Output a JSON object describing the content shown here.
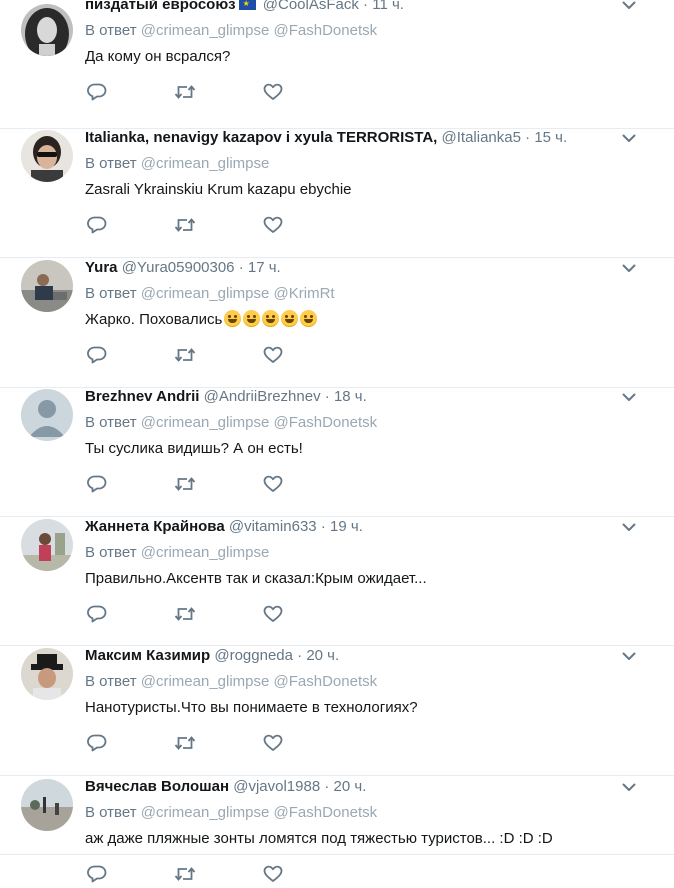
{
  "reply_prefix": "В ответ",
  "tweets": [
    {
      "name": "пиздатый евросоюз",
      "handle": "@CoolAsFack",
      "time": "11 ч.",
      "reply_mentions": "@crimean_glimpse @FashDonetsk",
      "text": "Да кому он всрался?",
      "has_flag": true,
      "emoji_count": 0
    },
    {
      "name": "Italianka, nenavigy kazapov i xyula TERRORISTA,",
      "handle": "@Italianka5",
      "time": "15 ч.",
      "reply_mentions": "@crimean_glimpse",
      "text": "Zasrali Ykrainskiu Krum kazapu ebychie",
      "has_flag": false,
      "emoji_count": 0
    },
    {
      "name": "Yura",
      "handle": "@Yura05900306",
      "time": "17 ч.",
      "reply_mentions": "@crimean_glimpse @KrimRt",
      "text": "Жарко. Поховались",
      "has_flag": false,
      "emoji_count": 5
    },
    {
      "name": "Brezhnev Andrii",
      "handle": "@AndriiBrezhnev",
      "time": "18 ч.",
      "reply_mentions": "@crimean_glimpse @FashDonetsk",
      "text": "Ты суслика видишь? А он есть!",
      "has_flag": false,
      "emoji_count": 0
    },
    {
      "name": "Жаннета Крайнова",
      "handle": "@vitamin633",
      "time": "19 ч.",
      "reply_mentions": "@crimean_glimpse",
      "text": "Правильно.Аксентв так и сказал:Крым ожидает...",
      "has_flag": false,
      "emoji_count": 0
    },
    {
      "name": "Максим Казимир",
      "handle": "@roggneda",
      "time": "20 ч.",
      "reply_mentions": "@crimean_glimpse @FashDonetsk",
      "text": "Нанотуристы.Что вы понимаете в технологиях?",
      "has_flag": false,
      "emoji_count": 0
    },
    {
      "name": "Вячеслав Волошан",
      "handle": "@vjavol1988",
      "time": "20 ч.",
      "reply_mentions": "@crimean_glimpse @FashDonetsk",
      "text": "аж даже пляжные зонты ломятся под тяжестью туристов... :D :D :D",
      "has_flag": false,
      "emoji_count": 0
    }
  ],
  "colors": {
    "secondary_text": "#657786",
    "mention": "#9aa8b3",
    "divider": "#e6ecf0",
    "icon": "#657786"
  }
}
